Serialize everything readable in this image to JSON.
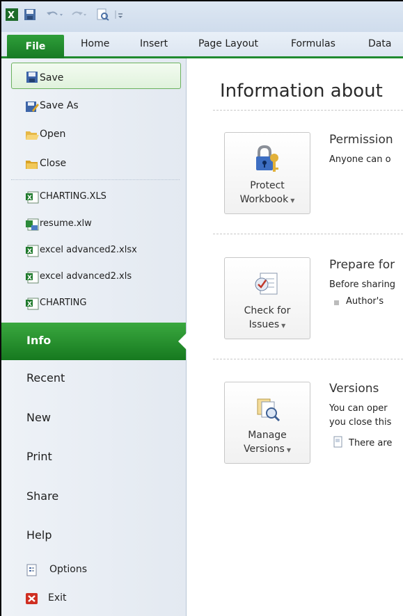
{
  "ribbon": {
    "file_tab": "File",
    "tabs": [
      "Home",
      "Insert",
      "Page Layout",
      "Formulas",
      "Data"
    ]
  },
  "quick_access": {
    "icons": [
      "excel-logo-icon",
      "save-icon",
      "undo-icon",
      "redo-icon",
      "print-preview-icon",
      "customize-dropdown-icon"
    ]
  },
  "file_menu": {
    "save": "Save",
    "save_as": "Save As",
    "open": "Open",
    "close": "Close",
    "recent_files": [
      "CHARTING.XLS",
      "resume.xlw",
      "excel advanced2.xlsx",
      "excel advanced2.xls",
      "CHARTING"
    ],
    "info": "Info",
    "recent": "Recent",
    "new": "New",
    "print": "Print",
    "share": "Share",
    "help": "Help",
    "options": "Options",
    "exit": "Exit"
  },
  "main": {
    "title": "Information about",
    "sections": [
      {
        "button_line1": "Protect",
        "button_line2": "Workbook",
        "heading": "Permission",
        "text1": "Anyone can o"
      },
      {
        "button_line1": "Check for",
        "button_line2": "Issues",
        "heading": "Prepare for",
        "text1": "Before sharing",
        "bullet": "Author's"
      },
      {
        "button_line1": "Manage",
        "button_line2": "Versions",
        "heading": "Versions",
        "text1": "You can oper",
        "text2": "you close this",
        "note": "There are"
      }
    ]
  },
  "colors": {
    "accent_green": "#1f8a2e",
    "info_bar": "#2a9a35"
  }
}
